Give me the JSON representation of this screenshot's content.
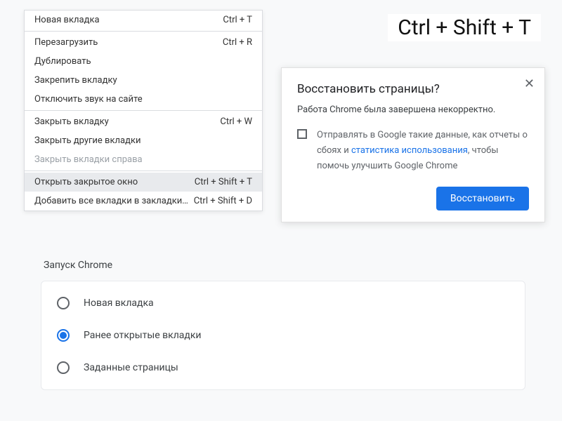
{
  "big_shortcut": "Ctrl + Shift + T",
  "context_menu": {
    "items": [
      {
        "label": "Новая вкладка",
        "shortcut": "Ctrl + T",
        "disabled": false
      },
      {
        "sep": true
      },
      {
        "label": "Перезагрузить",
        "shortcut": "Ctrl + R",
        "disabled": false
      },
      {
        "label": "Дублировать",
        "shortcut": "",
        "disabled": false
      },
      {
        "label": "Закрепить вкладку",
        "shortcut": "",
        "disabled": false
      },
      {
        "label": "Отключить звук на сайте",
        "shortcut": "",
        "disabled": false
      },
      {
        "sep": true
      },
      {
        "label": "Закрыть вкладку",
        "shortcut": "Ctrl + W",
        "disabled": false
      },
      {
        "label": "Закрыть другие вкладки",
        "shortcut": "",
        "disabled": false
      },
      {
        "label": "Закрыть вкладки справа",
        "shortcut": "",
        "disabled": true
      },
      {
        "sep": true
      },
      {
        "label": "Открыть закрытое окно",
        "shortcut": "Ctrl + Shift + T",
        "disabled": false,
        "highlight": true
      },
      {
        "label": "Добавить все вкладки в закладки…",
        "shortcut": "Ctrl + Shift + D",
        "disabled": false
      }
    ]
  },
  "dialog": {
    "title": "Восстановить страницы?",
    "subtitle": "Работа Chrome была завершена некорректно.",
    "body_prefix": "Отправлять в Google такие данные, как отчеты о сбоях и ",
    "body_link": "статистика использования",
    "body_suffix": ", чтобы помочь улучшить Google Chrome",
    "button": "Восстановить"
  },
  "settings": {
    "title": "Запуск Chrome",
    "options": [
      {
        "label": "Новая вкладка",
        "selected": false
      },
      {
        "label": "Ранее открытые вкладки",
        "selected": true
      },
      {
        "label": "Заданные страницы",
        "selected": false
      }
    ]
  }
}
